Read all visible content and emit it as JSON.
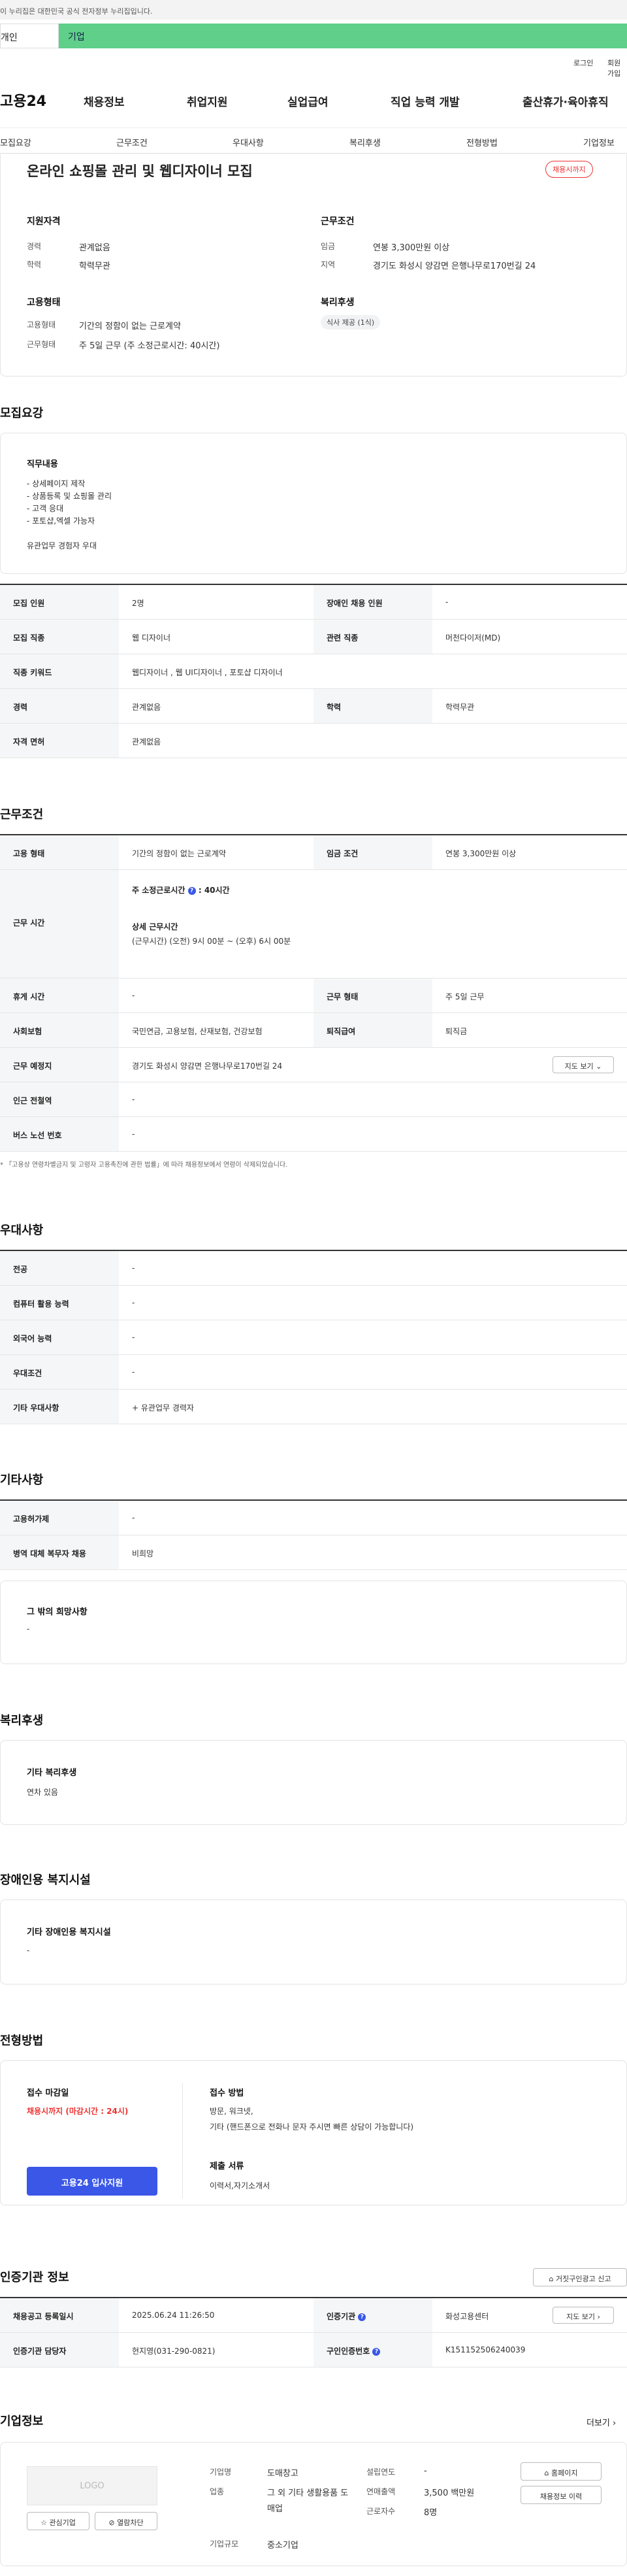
{
  "gov_notice": "이 누리집은 대한민국 공식 전자정부 누리집입니다.",
  "tabs": {
    "individual": "개인",
    "company": "기업"
  },
  "util": {
    "login": "로그인",
    "join": "회원가입"
  },
  "logo": "고용24",
  "gnb": [
    "채용정보",
    "취업지원",
    "실업급여",
    "직업 능력 개발",
    "출산휴가·육아휴직"
  ],
  "snb": [
    "모집요강",
    "근무조건",
    "우대사항",
    "복리후생",
    "전형방법",
    "기업정보"
  ],
  "summary": {
    "title": "온라인 쇼핑몰 관리 및 웹디자이너 모집",
    "badge": "채용시까지",
    "qual_title": "지원자격",
    "career_label": "경력",
    "career_value": "관계없음",
    "edu_label": "학력",
    "edu_value": "학력무관",
    "emp_title": "고용형태",
    "emp_label": "고용형태",
    "emp_value": "기간의 정함이 없는 근로계약",
    "work_label": "근무형태",
    "work_value": "주 5일 근무 (주 소정근로시간: 40시간)",
    "cond_title": "근무조건",
    "wage_label": "임금",
    "wage_value": "연봉 3,300만원 이상",
    "region_label": "지역",
    "region_value": "경기도 화성시 양감면 은행나무로170번길 24",
    "welfare_title": "복리후생",
    "welfare_chip": "식사 제공 (1식)"
  },
  "recruit": {
    "heading": "모집요강",
    "job_title": "직무내용",
    "job_lines": [
      "- 상세페이지 제작",
      "- 상품등록 및 쇼핑몰 관리",
      "- 고객 응대",
      "- 포토샵,엑셀 가능자",
      "",
      "유관업무 경험자 우대"
    ],
    "table": [
      [
        "모집 인원",
        "2명",
        "장애인 채용 인원",
        "-"
      ],
      [
        "모집 직종",
        "웹 디자이너",
        "관련 직종",
        "머천다이저(MD)"
      ],
      [
        "직종 키워드",
        "웹디자이너 , 웹 UI디자이너 , 포토샵 디자이너",
        "",
        ""
      ],
      [
        "경력",
        "관계없음",
        "학력",
        "학력무관"
      ],
      [
        "자격 면허",
        "관계없음",
        "",
        ""
      ]
    ]
  },
  "conditions": {
    "heading": "근무조건",
    "emp_label": "고용 형태",
    "emp_value": "기간의 정함이 없는 근로계약",
    "wage_label": "임금 조건",
    "wage_value": "연봉 3,300만원 이상",
    "hours_label": "근무 시간",
    "hours_main": "주 소정근로시간",
    "hours_main_value": ": 40시간",
    "hours_detail_title": "상세 근무시간",
    "hours_detail": "(근무시간) (오전) 9시 00분 ~ (오후) 6시 00분",
    "rest_label": "휴게 시간",
    "rest_value": "-",
    "form_label": "근무 형태",
    "form_value": "주 5일 근무",
    "ins_label": "사회보험",
    "ins_value": "국민연금, 고용보험, 산재보험, 건강보험",
    "sev_label": "퇴직급여",
    "sev_value": "퇴직금",
    "place_label": "근무 예정지",
    "place_value": "경기도 화성시 양감면 은행나무로170번길 24",
    "map_btn": "지도 보기",
    "station_label": "인근 전철역",
    "station_value": "-",
    "bus_label": "버스 노선 번호",
    "bus_value": "-",
    "note": "「고용상 연령차별금지 및 고령자 고용촉진에 관한 법률」에 따라 채용정보에서 연령이 삭제되었습니다."
  },
  "prefer": {
    "heading": "우대사항",
    "rows": [
      [
        "전공",
        "-"
      ],
      [
        "컴퓨터 활용 능력",
        "-"
      ],
      [
        "외국어 능력",
        "-"
      ],
      [
        "우대조건",
        "-"
      ],
      [
        "기타 우대사항",
        "+ 유관업무 경력자"
      ]
    ]
  },
  "etc": {
    "heading": "기타사항",
    "rows": [
      [
        "고용허가제",
        "-"
      ],
      [
        "병역 대체 복무자 채용",
        "비희망"
      ]
    ],
    "wish_title": "그 밖의 희망사항",
    "wish_value": "-"
  },
  "welfare": {
    "heading": "복리후생",
    "title": "기타 복리후생",
    "value": "연차 있음"
  },
  "disabled": {
    "heading": "장애인용 복지시설",
    "title": "기타 장애인용 복지시설",
    "value": "-"
  },
  "process": {
    "heading": "전형방법",
    "deadline_title": "접수 마감일",
    "deadline_value": "채용시까지 (마감시간 : 24시)",
    "apply_btn": "고용24 입사지원",
    "method_title": "접수 방법",
    "method_1": "방문, 워크넷,",
    "method_2": "기타 (핸드폰으로 전화나 문자 주시면 빠른 상담이 가능합니다)",
    "docs_title": "제출 서류",
    "docs_value": "이력서,자기소개서"
  },
  "agency": {
    "heading": "인증기관 정보",
    "report_btn": "거짓구인광고 신고",
    "reg_label": "채용공고 등록일시",
    "reg_value": "2025.06.24 11:26:50",
    "org_label": "인증기관",
    "org_value": "화성고용센터",
    "map_btn": "지도 보기",
    "manager_label": "인증기관 담당자",
    "manager_value": "현지영(031-290-0821)",
    "no_label": "구인인증번호",
    "no_value": "K151152506240039"
  },
  "company": {
    "heading": "기업정보",
    "more": "더보기",
    "logo_text": "LOGO",
    "fav_btn": "관심기업",
    "block_btn": "열람차단",
    "name_label": "기업명",
    "name_value": "도매창고",
    "industry_label": "업종",
    "industry_value": "그 외 기타 생활용품 도매업",
    "size_label": "기업규모",
    "size_value": "중소기업",
    "year_label": "설립연도",
    "year_value": "-",
    "sales_label": "연매출액",
    "sales_value": "3,500 백만원",
    "emp_label": "근로자수",
    "emp_value": "8명",
    "homepage_btn": "홈페이지",
    "history_btn": "채용정보 이력"
  }
}
